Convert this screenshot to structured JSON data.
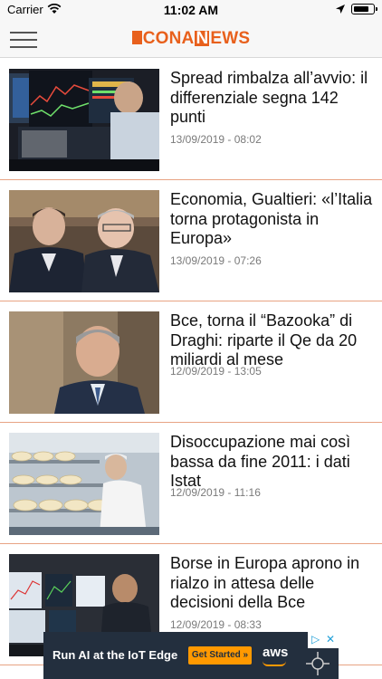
{
  "status_bar": {
    "carrier": "Carrier",
    "time": "11:02 AM"
  },
  "header": {
    "logo_prefix": "CONA",
    "logo_box": "N",
    "logo_suffix": "EWS",
    "brand_color": "#e8601c"
  },
  "articles": [
    {
      "headline": "Spread rimbalza all’avvio: il differenziale segna 142 punti",
      "date": "13/09/2019 - 08:02",
      "thumb": "trader-screens"
    },
    {
      "headline": "Economia, Gualtieri: «l’Italia torna protagonista in Europa»",
      "date": "13/09/2019 - 07:26",
      "thumb": "two-politicians"
    },
    {
      "headline": "Bce, torna il “Bazooka” di Draghi: riparte il Qe da 20 miliardi al mese",
      "date": "12/09/2019 - 13:05",
      "thumb": "man-portrait"
    },
    {
      "headline": "Disoccupazione mai così bassa da fine 2011: i dati Istat",
      "date": "12/09/2019 - 11:16",
      "thumb": "cheese-factory"
    },
    {
      "headline": "Borse in Europa aprono in rialzo in attesa delle decisioni della Bce",
      "date": "12/09/2019 - 08:33",
      "thumb": "stock-monitors"
    }
  ],
  "ad": {
    "text": "Run AI at the IoT Edge",
    "cta": "Get Started »",
    "brand": "aws"
  }
}
